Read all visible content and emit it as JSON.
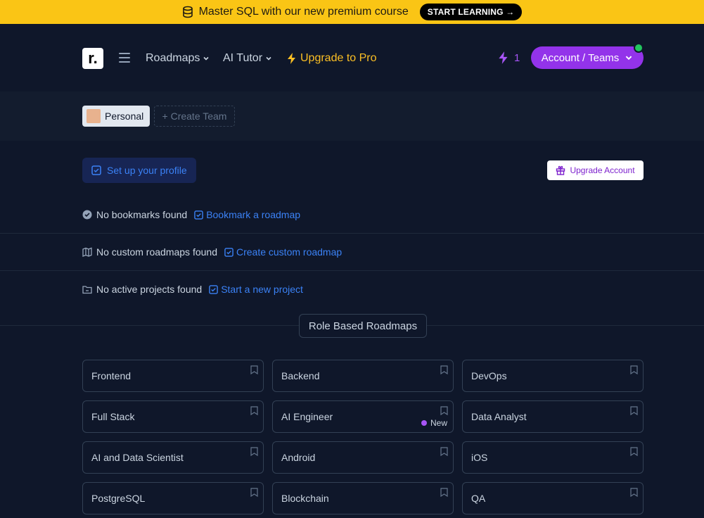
{
  "banner": {
    "text": "Master SQL with our new premium course",
    "cta_label": "START LEARNING →",
    "icon": "database-icon",
    "bg_color": "#fac515"
  },
  "nav": {
    "logo_text": "r.",
    "roadmaps_label": "Roadmaps",
    "ai_tutor_label": "AI Tutor",
    "upgrade_label": "Upgrade to Pro",
    "streak_count": "1",
    "account_label": "Account / Teams",
    "accent_color": "#9333ea",
    "upgrade_color": "#fbbf24"
  },
  "teams": {
    "personal_label": "Personal",
    "create_team_label": "+ Create Team"
  },
  "profile": {
    "setup_label": "Set up your profile",
    "upgrade_account_label": "Upgrade Account"
  },
  "empty_states": {
    "bookmarks": {
      "text": "No bookmarks found",
      "link": "Bookmark a roadmap"
    },
    "custom": {
      "text": "No custom roadmaps found",
      "link": "Create custom roadmap"
    },
    "projects": {
      "text": "No active projects found",
      "link": "Start a new project"
    }
  },
  "section": {
    "title": "Role Based Roadmaps"
  },
  "roadmaps": [
    {
      "label": "Frontend"
    },
    {
      "label": "Backend"
    },
    {
      "label": "DevOps"
    },
    {
      "label": "Full Stack"
    },
    {
      "label": "AI Engineer",
      "badge": "New"
    },
    {
      "label": "Data Analyst"
    },
    {
      "label": "AI and Data Scientist"
    },
    {
      "label": "Android"
    },
    {
      "label": "iOS"
    },
    {
      "label": "PostgreSQL"
    },
    {
      "label": "Blockchain"
    },
    {
      "label": "QA"
    }
  ]
}
